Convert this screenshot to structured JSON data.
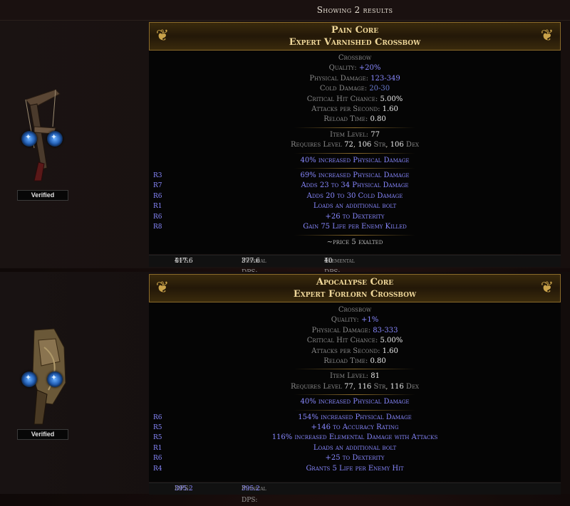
{
  "results_text": "Showing 2 results",
  "items": [
    {
      "name": "Pain Core",
      "base": "Expert Varnished Crossbow",
      "class": "Crossbow",
      "quality_label": "Quality:",
      "quality_value": "+20%",
      "phys_label": "Physical Damage:",
      "phys_value": "123-349",
      "cold_label": "Cold Damage:",
      "cold_value": "20-30",
      "crit_label": "Critical Hit Chance:",
      "crit_value": "5.00%",
      "aps_label": "Attacks per Second:",
      "aps_value": "1.60",
      "reload_label": "Reload Time:",
      "reload_value": "0.80",
      "ilvl_label": "Item Level:",
      "ilvl_value": "77",
      "req_prefix": "Requires Level",
      "req_level": "72",
      "req_str": "106",
      "req_str_label": "Str",
      "req_dex": "106",
      "req_dex_label": "Dex",
      "implicit": "40% increased Physical Damage",
      "mods": [
        {
          "tier": "R3",
          "text": "69% increased Physical Damage"
        },
        {
          "tier": "R7",
          "text": "Adds 23 to 34 Physical Damage"
        },
        {
          "tier": "R6",
          "text": "Adds 20 to 30 Cold Damage"
        },
        {
          "tier": "R1",
          "text": "Loads an additional bolt"
        },
        {
          "tier": "R6",
          "text": "+26 to Dexterity"
        },
        {
          "tier": "R8",
          "text": "Gain 75 Life per Enemy Killed"
        }
      ],
      "price_note": "~price 5 exalted",
      "dps_label": "DPS:",
      "dps_value": "417.6",
      "pdps_label": "Physical DPS:",
      "pdps_value": "377.6",
      "edps_label": "Elemental DPS:",
      "edps_value": "40",
      "verified_label": "Verified"
    },
    {
      "name": "Apocalypse Core",
      "base": "Expert Forlorn Crossbow",
      "class": "Crossbow",
      "quality_label": "Quality:",
      "quality_value": "+1%",
      "phys_label": "Physical Damage:",
      "phys_value": "83-333",
      "crit_label": "Critical Hit Chance:",
      "crit_value": "5.00%",
      "aps_label": "Attacks per Second:",
      "aps_value": "1.60",
      "reload_label": "Reload Time:",
      "reload_value": "0.80",
      "ilvl_label": "Item Level:",
      "ilvl_value": "81",
      "req_prefix": "Requires Level",
      "req_level": "77",
      "req_str": "116",
      "req_str_label": "Str",
      "req_dex": "116",
      "req_dex_label": "Dex",
      "implicit": "40% increased Physical Damage",
      "mods": [
        {
          "tier": "R6",
          "text": "154% increased Physical Damage"
        },
        {
          "tier": "R5",
          "text": "+146 to Accuracy Rating"
        },
        {
          "tier": "R5",
          "text": "116% increased Elemental Damage with Attacks"
        },
        {
          "tier": "R1",
          "text": "Loads an additional bolt"
        },
        {
          "tier": "R6",
          "text": "+25 to Dexterity"
        },
        {
          "tier": "R4",
          "text": "Grants 5 Life per Enemy Hit"
        }
      ],
      "dps_label": "DPS:",
      "dps_value": "395.2",
      "pdps_label": "Physical DPS:",
      "pdps_value": "395.2",
      "verified_label": "Verified"
    }
  ],
  "icons": [
    "crossbow-icon",
    "socket-icon",
    "header-ornament-icon"
  ]
}
